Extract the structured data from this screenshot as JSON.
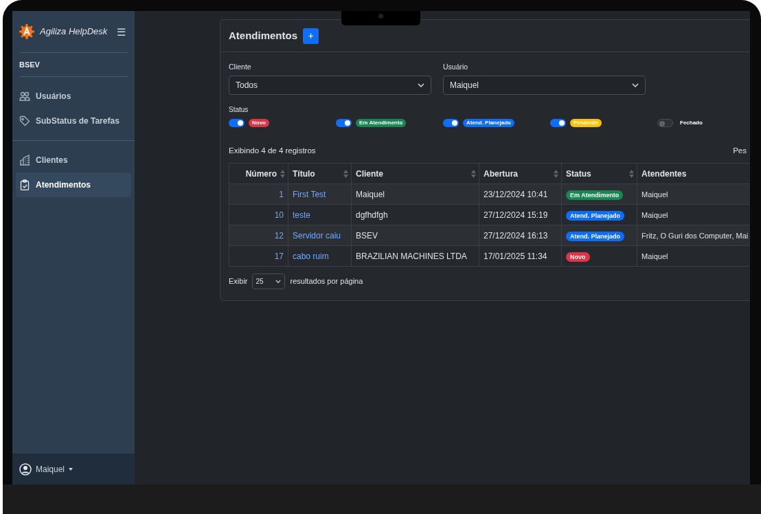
{
  "sidebar": {
    "brand": "Agiliza HelpDesk",
    "menu_icon": "☰",
    "company": "BSEV",
    "groups": [
      [
        {
          "label": "Usuários",
          "selected": false
        },
        {
          "label": "SubStatus de Tarefas",
          "selected": false
        }
      ],
      [
        {
          "label": "Clientes",
          "selected": false
        },
        {
          "label": "Atendimentos",
          "selected": true
        }
      ]
    ],
    "user": "Maiquel"
  },
  "main": {
    "title": "Atendimentos",
    "add_button": "+",
    "filters": [
      {
        "label": "Cliente",
        "value": "Todos"
      },
      {
        "label": "Usuário",
        "value": "Maiquel"
      }
    ],
    "status_label": "Status",
    "status_toggles": [
      {
        "label": "Novo",
        "on": true,
        "color": "#dc3545"
      },
      {
        "label": "Em Atendimento",
        "on": true,
        "color": "#198754"
      },
      {
        "label": "Atend. Planejado",
        "on": true,
        "color": "#0d6efd"
      },
      {
        "label": "Pendente",
        "on": true,
        "color": "#ffc107"
      },
      {
        "label": "Fechado",
        "on": false
      }
    ],
    "info": "Exibindo 4 de 4 registros",
    "search_label": "Pes",
    "table": {
      "columns": [
        {
          "label": "Número",
          "sortable": true
        },
        {
          "label": "Título",
          "sortable": true
        },
        {
          "label": "Cliente",
          "sortable": true
        },
        {
          "label": "Abertura",
          "sortable": true
        },
        {
          "label": "Status",
          "sortable": true
        },
        {
          "label": "Atendentes"
        }
      ],
      "rows": [
        {
          "number": "1",
          "title": "First Test",
          "client": "Maiquel",
          "opened": "23/12/2024 10:41",
          "status": {
            "label": "Em Atendimento",
            "color": "#198754"
          },
          "agents": "Maiquel"
        },
        {
          "number": "10",
          "title": "teste",
          "client": "dgfhdfgh",
          "opened": "27/12/2024 15:19",
          "status": {
            "label": "Atend. Planejado",
            "color": "#0d6efd"
          },
          "agents": "Maiquel"
        },
        {
          "number": "12",
          "title": "Servidor caiu",
          "client": "BSEV",
          "opened": "27/12/2024 16:13",
          "status": {
            "label": "Atend. Planejado",
            "color": "#0d6efd"
          },
          "agents": "Fritz, O Guri dos Computer, Mai"
        },
        {
          "number": "17",
          "title": "cabo ruim",
          "client": "BRAZILIAN MACHINES LTDA",
          "opened": "17/01/2025 11:34",
          "status": {
            "label": "Novo",
            "color": "#dc3545"
          },
          "agents": "Maiquel"
        }
      ]
    },
    "page_size": {
      "label": "Exibir",
      "value": "25",
      "suffix": "resultados por página"
    }
  }
}
